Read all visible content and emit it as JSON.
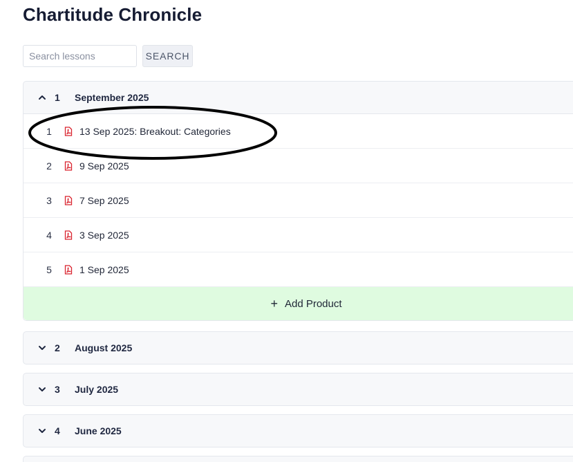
{
  "page": {
    "title": "Chartitude Chronicle"
  },
  "search": {
    "placeholder": "Search lessons",
    "value": "",
    "button_label": "SEARCH"
  },
  "sections": [
    {
      "number": "1",
      "title": "September 2025",
      "expanded": true,
      "items": [
        {
          "number": "1",
          "label": "13 Sep 2025: Breakout: Categories"
        },
        {
          "number": "2",
          "label": "9 Sep 2025"
        },
        {
          "number": "3",
          "label": "7 Sep 2025"
        },
        {
          "number": "4",
          "label": "3 Sep 2025"
        },
        {
          "number": "5",
          "label": "1 Sep 2025"
        }
      ],
      "add_label": "Add Product"
    },
    {
      "number": "2",
      "title": "August 2025",
      "expanded": false
    },
    {
      "number": "3",
      "title": "July 2025",
      "expanded": false
    },
    {
      "number": "4",
      "title": "June 2025",
      "expanded": false
    }
  ],
  "colors": {
    "accent_add": "#dffbe0",
    "pdf_icon": "#d9232e",
    "annotation": "#000000"
  },
  "icons": {
    "expanded": "chevron-up-icon",
    "collapsed": "chevron-down-icon",
    "item": "pdf-icon",
    "add": "plus-icon"
  }
}
